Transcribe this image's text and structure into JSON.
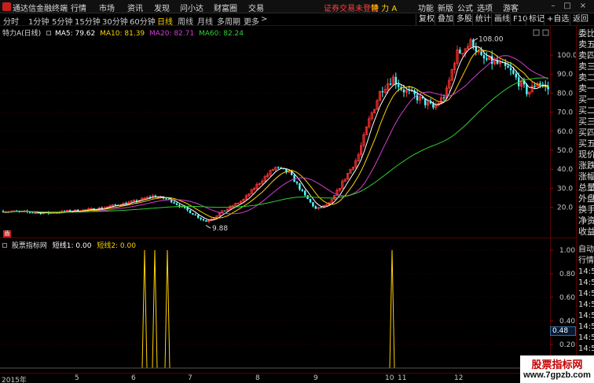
{
  "header": {
    "app_title": "通达信金融终端",
    "menu": [
      "行情",
      "市场",
      "资讯",
      "发现",
      "问小达",
      "财富圈",
      "交易"
    ],
    "login_warning": "证券交易未登录",
    "stock_name": "特 力 A",
    "right_menu": [
      "功能",
      "新版",
      "公式",
      "选项",
      "游客"
    ],
    "window_buttons": [
      "–",
      "□",
      "×"
    ]
  },
  "period_bar": {
    "tabs": [
      "分时",
      "1分钟",
      "5分钟",
      "15分钟",
      "30分钟",
      "60分钟",
      "日线",
      "周线",
      "月线",
      "多周期",
      "更多"
    ],
    "active": "日线",
    "more_arrow": ">",
    "right_tools": [
      "复权",
      "叠加",
      "多股",
      "统计",
      "画线",
      "F10",
      "标记",
      "+自选",
      "返回"
    ]
  },
  "main_legend": {
    "title": "特力A(日线)",
    "ma": [
      {
        "label": "MA5: 79.62",
        "color": "#ffffff"
      },
      {
        "label": "MA10: 81.39",
        "color": "#ffd200"
      },
      {
        "label": "MA20: 82.71",
        "color": "#d040d0"
      },
      {
        "label": "MA60: 82.24",
        "color": "#30d030"
      }
    ]
  },
  "main_chart": {
    "price_axis": [
      "100.0",
      "90.0",
      "80.0",
      "70.0",
      "60.0",
      "50.0",
      "40.0",
      "30.0",
      "20.0"
    ],
    "high_label": "108.00",
    "low_label": "9.88",
    "colors": {
      "up": "#ff3232",
      "down": "#54ffff",
      "ma5": "#ffffff",
      "ma10": "#ffd200",
      "ma20": "#d040d0",
      "ma60": "#30d030"
    }
  },
  "sub_legend": {
    "title": "股票指标网",
    "items": [
      {
        "label": "短线1: 0.00",
        "color": "#ffffff"
      },
      {
        "label": "短线2: 0.00",
        "color": "#ffd200"
      }
    ]
  },
  "sub_chart": {
    "axis": [
      "1.00",
      "0.80",
      "0.60",
      "0.40",
      "0.20"
    ],
    "value_box": "0.48",
    "corner_label": "盾",
    "line_color": "#ffd200"
  },
  "time_axis": [
    "2015年",
    "5",
    "6",
    "7",
    "8",
    "9",
    "10",
    "11",
    "12"
  ],
  "sidebar": {
    "top": [
      "委比",
      "卖五",
      "卖四",
      "卖三",
      "卖二",
      "卖一",
      "买一",
      "买二",
      "买三",
      "买四",
      "买五",
      "现价",
      "涨跌",
      "涨幅",
      "总量",
      "外盘",
      "换手",
      "净资",
      "收益"
    ],
    "bottom": [
      "自动",
      "行情",
      "14:56",
      "14:56",
      "14:56",
      "14:56",
      "14:56",
      "14:56",
      "14:56",
      "14:56"
    ]
  },
  "watermark": {
    "title": "股票指标网",
    "url": "www.7gpzb.com"
  }
}
